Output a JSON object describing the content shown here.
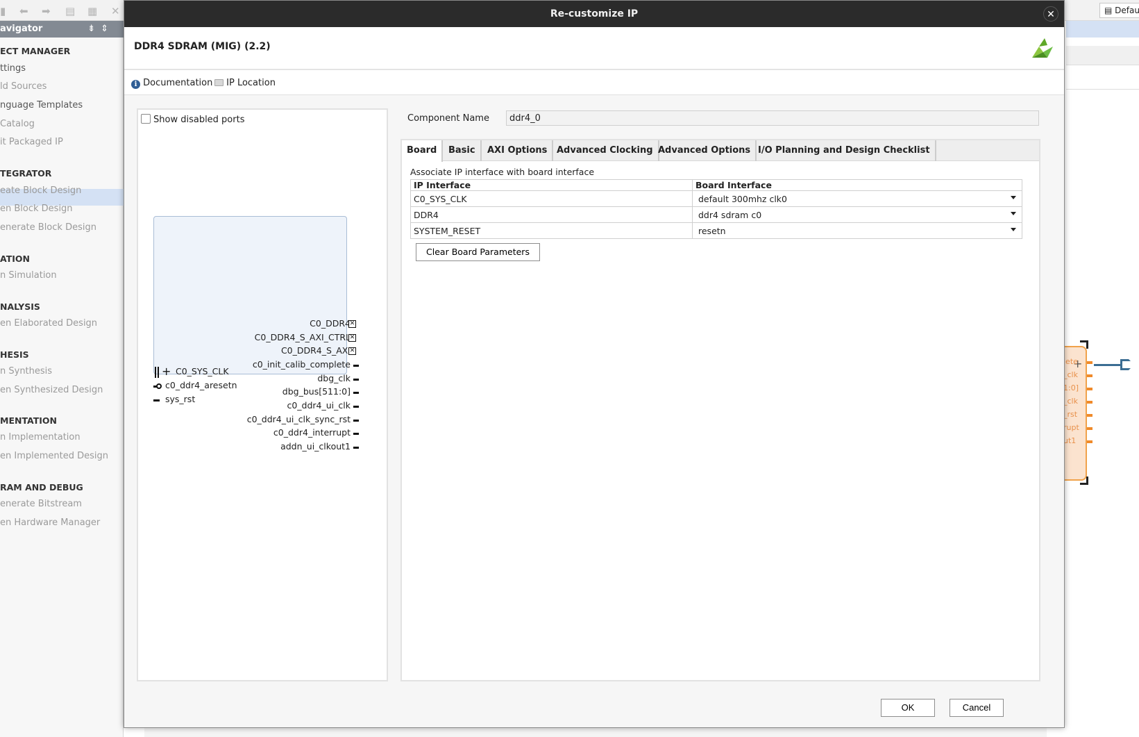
{
  "background": {
    "navigator_title": "avigator",
    "nav_items": [
      {
        "label": "ECT MANAGER",
        "kind": "section"
      },
      {
        "label": "ttings",
        "kind": "enabled"
      },
      {
        "label": "ld Sources",
        "kind": "disabled"
      },
      {
        "label": "nguage Templates",
        "kind": "enabled"
      },
      {
        "label": "Catalog",
        "kind": "disabled"
      },
      {
        "label": "it Packaged IP",
        "kind": "disabled"
      },
      {
        "label": "TEGRATOR",
        "kind": "section"
      },
      {
        "label": "eate Block Design",
        "kind": "disabled"
      },
      {
        "label": "en Block Design",
        "kind": "disabled"
      },
      {
        "label": "enerate Block Design",
        "kind": "disabled"
      },
      {
        "label": "ATION",
        "kind": "section"
      },
      {
        "label": "n Simulation",
        "kind": "disabled"
      },
      {
        "label": "NALYSIS",
        "kind": "section"
      },
      {
        "label": "en Elaborated Design",
        "kind": "disabled"
      },
      {
        "label": "HESIS",
        "kind": "section"
      },
      {
        "label": "n Synthesis",
        "kind": "disabled"
      },
      {
        "label": "en Synthesized Design",
        "kind": "disabled"
      },
      {
        "label": "MENTATION",
        "kind": "section"
      },
      {
        "label": "n Implementation",
        "kind": "disabled"
      },
      {
        "label": "en Implemented Design",
        "kind": "disabled"
      },
      {
        "label": "RAM AND DEBUG",
        "kind": "section"
      },
      {
        "label": "enerate Bitstream",
        "kind": "disabled"
      },
      {
        "label": "en Hardware Manager",
        "kind": "disabled"
      }
    ],
    "default_button": "Defau",
    "canvas_port_labels": [
      "lete",
      "_clk",
      "1:0]",
      "_clk",
      "_rst",
      "rupt",
      "ut1"
    ]
  },
  "dialog": {
    "title": "Re-customize IP",
    "ip_name": "DDR4 SDRAM (MIG) (2.2)",
    "links": {
      "documentation": "Documentation",
      "ip_location": "IP Location"
    },
    "show_disabled_ports": "Show disabled ports",
    "component_name_label": "Component Name",
    "component_name_value": "ddr4_0",
    "tabs": [
      "Board",
      "Basic",
      "AXI Options",
      "Advanced Clocking",
      "Advanced Options",
      "I/O Planning and Design Checklist"
    ],
    "active_tab": "Board",
    "board": {
      "associate_label": "Associate IP interface with board interface",
      "columns": [
        "IP Interface",
        "Board Interface"
      ],
      "rows": [
        {
          "ip": "C0_SYS_CLK",
          "board": "default 300mhz clk0"
        },
        {
          "ip": "DDR4",
          "board": "ddr4 sdram c0"
        },
        {
          "ip": "SYSTEM_RESET",
          "board": "resetn"
        }
      ],
      "clear_button": "Clear Board Parameters"
    },
    "symbol": {
      "right_ports": [
        "C0_DDR4",
        "C0_DDR4_S_AXI_CTRL",
        "C0_DDR4_S_AXI",
        "c0_init_calib_complete",
        "dbg_clk",
        "dbg_bus[511:0]",
        "c0_ddr4_ui_clk",
        "c0_ddr4_ui_clk_sync_rst",
        "c0_ddr4_interrupt",
        "addn_ui_clkout1"
      ],
      "left_ports": [
        "C0_SYS_CLK",
        "c0_ddr4_aresetn",
        "sys_rst"
      ]
    },
    "ok_button": "OK",
    "cancel_button": "Cancel"
  }
}
